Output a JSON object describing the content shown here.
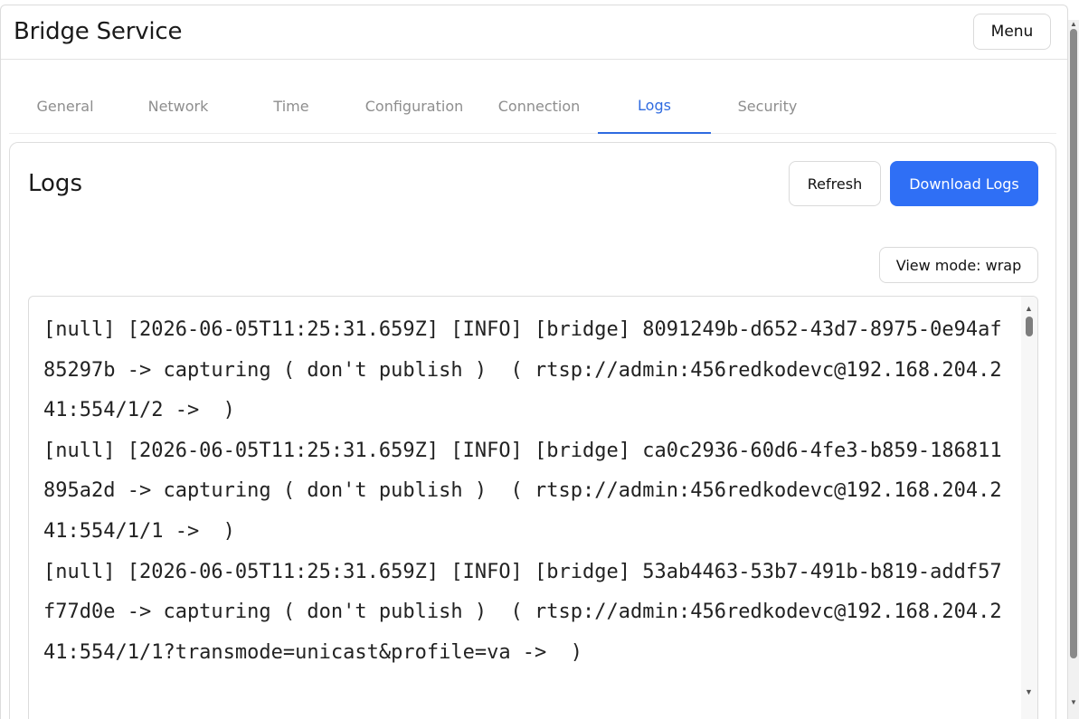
{
  "header": {
    "title": "Bridge Service",
    "menu_label": "Menu"
  },
  "tabs": [
    {
      "label": "General"
    },
    {
      "label": "Network"
    },
    {
      "label": "Time"
    },
    {
      "label": "Configuration"
    },
    {
      "label": "Connection"
    },
    {
      "label": "Logs",
      "active": true
    },
    {
      "label": "Security"
    }
  ],
  "logs_panel": {
    "title": "Logs",
    "refresh_label": "Refresh",
    "download_label": "Download Logs",
    "view_mode_label": "View mode: wrap",
    "lines": [
      "[null] [2026-06-05T11:25:31.659Z] [INFO] [bridge] 8091249b-d652-43d7-8975-0e94af85297b -> capturing ( don't publish )  ( rtsp://admin:456redkodevc@192.168.204.241:554/1/2 ->  )",
      "[null] [2026-06-05T11:25:31.659Z] [INFO] [bridge] ca0c2936-60d6-4fe3-b859-186811895a2d -> capturing ( don't publish )  ( rtsp://admin:456redkodevc@192.168.204.241:554/1/1 ->  )",
      "[null] [2026-06-05T11:25:31.659Z] [INFO] [bridge] 53ab4463-53b7-491b-b819-addf57f77d0e -> capturing ( don't publish )  ( rtsp://admin:456redkodevc@192.168.204.241:554/1/1?transmode=unicast&profile=va ->  )"
    ]
  },
  "colors": {
    "accent": "#2f6ff5",
    "active_tab": "#2f6be0",
    "inactive_tab": "#8e8e8e"
  }
}
